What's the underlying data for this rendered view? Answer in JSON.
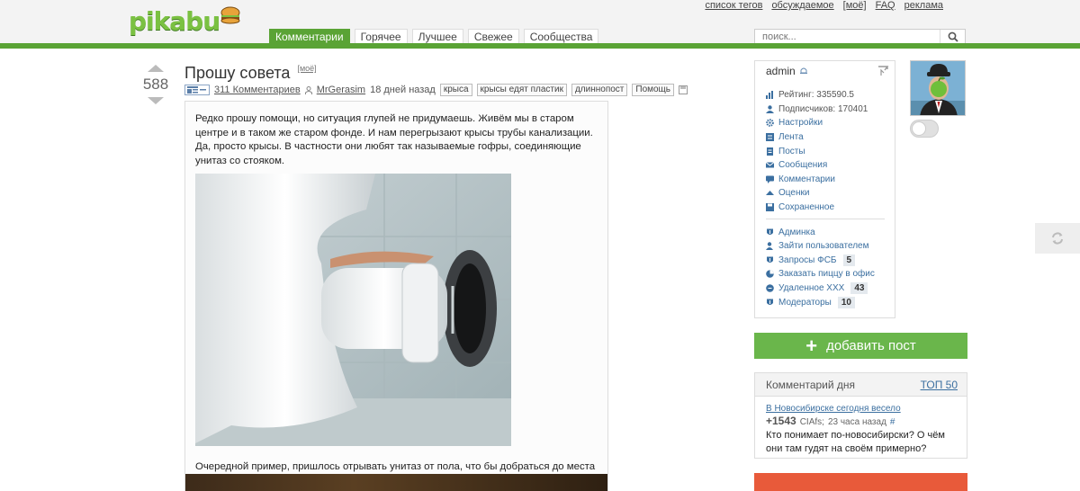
{
  "header": {
    "logo": "pikabu",
    "top_links": [
      "список тегов",
      "обсуждаемое",
      "[моё]",
      "FAQ",
      "реклама"
    ],
    "nav_tabs": [
      {
        "label": "Комментарии",
        "active": true
      },
      {
        "label": "Горячее",
        "active": false
      },
      {
        "label": "Лучшее",
        "active": false
      },
      {
        "label": "Свежее",
        "active": false
      },
      {
        "label": "Сообщества",
        "active": false
      }
    ],
    "search_placeholder": "поиск..."
  },
  "post": {
    "rating": "588",
    "title": "Прошу совета",
    "mine_label": "[моё]",
    "comments": "311 Комментариев",
    "author": "MrGerasim",
    "time": "18 дней назад",
    "tags": [
      "крыса",
      "крысы едят пластик",
      "длиннопост",
      "Помощь"
    ],
    "text1": "Редко прошу помощи, но ситуация глупей не придумаешь. Живём мы в старом центре и в таком же старом фонде. И нам перегрызают крысы трубы канализации. Да, просто крысы. В частности они любят так называемые гофры, соединяющие унитаз со стояком.",
    "text2": "Очередной пример, пришлось отрывать унитаз от пола, что бы добраться до места соединения. Сори канеш за натуральность, но из песни слов не выкинешь."
  },
  "profile": {
    "username": "admin",
    "stats": [
      {
        "label": "Рейтинг: 335590.5",
        "icon": "chart-icon"
      },
      {
        "label": "Подписчиков: 170401",
        "icon": "user-icon"
      }
    ],
    "menu": [
      "Настройки",
      "Лента",
      "Посты",
      "Сообщения",
      "Комментарии",
      "Оценки",
      "Сохраненное"
    ],
    "admin_menu": [
      {
        "label": "Админка",
        "badge": ""
      },
      {
        "label": "Зайти пользователем",
        "badge": ""
      },
      {
        "label": "Запросы ФСБ",
        "badge": "5"
      },
      {
        "label": "Заказать пиццу в офис",
        "badge": ""
      },
      {
        "label": "Удаленное XXX",
        "badge": "43"
      },
      {
        "label": "Модераторы",
        "badge": "10"
      }
    ]
  },
  "add_post": "добавить пост",
  "comment_of_day": {
    "title": "Комментарий дня",
    "top_link": "ТОП 50",
    "post_link": "В Новосибирске сегодня весело",
    "score": "+1543",
    "user": "CIAfs;",
    "time": "23 часа назад",
    "hash": "#",
    "text": "Кто понимает по-новосибирски? О чём они там гудят на своём примерно?"
  },
  "colors": {
    "brand_green": "#5aa335",
    "link_blue": "#3b6fa0",
    "button_green": "#6ab64b"
  }
}
